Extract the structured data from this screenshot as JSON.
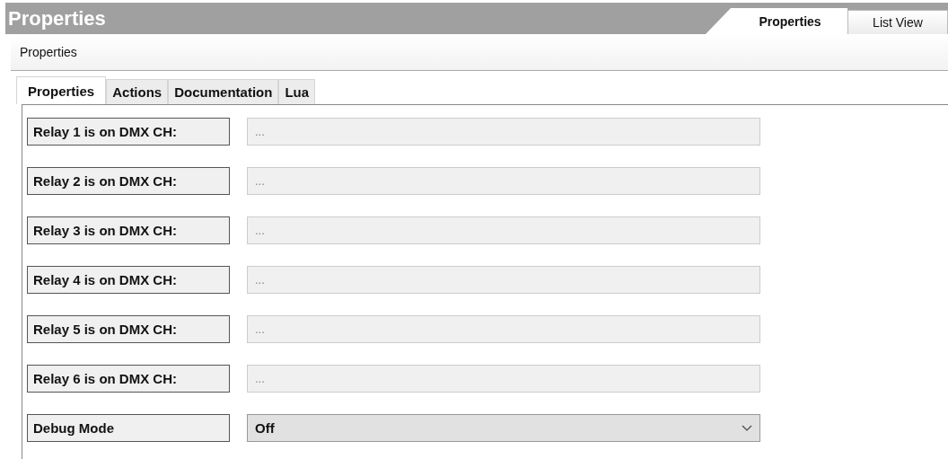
{
  "header": {
    "title": "Properties",
    "view_tabs": [
      {
        "label": "Properties",
        "selected": true
      },
      {
        "label": "List View",
        "selected": false
      }
    ]
  },
  "section_label": "Properties",
  "tabs": [
    {
      "label": "Properties",
      "selected": true
    },
    {
      "label": "Actions",
      "selected": false
    },
    {
      "label": "Documentation",
      "selected": false
    },
    {
      "label": "Lua",
      "selected": false
    }
  ],
  "properties": [
    {
      "label": "Relay 1 is on DMX CH:",
      "kind": "text",
      "value": "...",
      "disabled": true
    },
    {
      "label": "Relay 2 is on DMX CH:",
      "kind": "text",
      "value": "...",
      "disabled": true
    },
    {
      "label": "Relay 3 is on DMX CH:",
      "kind": "text",
      "value": "...",
      "disabled": true
    },
    {
      "label": "Relay 4 is on DMX CH:",
      "kind": "text",
      "value": "...",
      "disabled": true
    },
    {
      "label": "Relay 5 is on DMX CH:",
      "kind": "text",
      "value": "...",
      "disabled": true
    },
    {
      "label": "Relay 6 is on DMX CH:",
      "kind": "text",
      "value": "...",
      "disabled": true
    },
    {
      "label": "Debug Mode",
      "kind": "select",
      "value": "Off",
      "disabled": false
    }
  ]
}
